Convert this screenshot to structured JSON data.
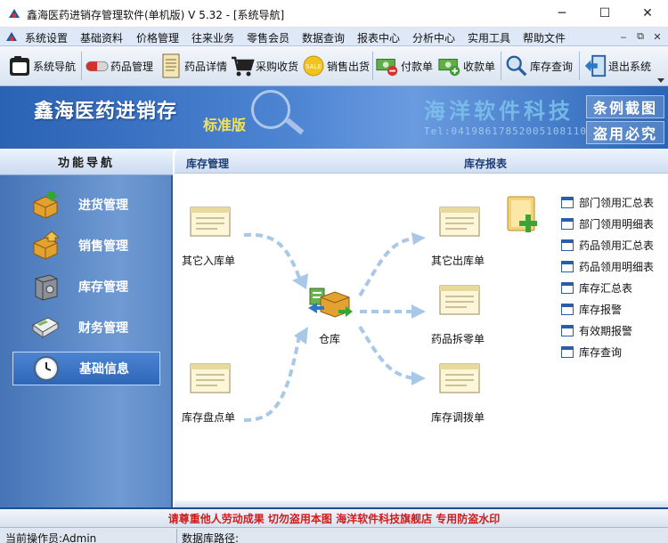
{
  "window": {
    "title": "鑫海医药进销存管理软件(单机版) V 5.32 - [系统导航]",
    "minimize_glyph": "─",
    "maximize_glyph": "☐",
    "close_glyph": "✕"
  },
  "menubar": {
    "items": [
      {
        "label": "系统设置"
      },
      {
        "label": "基础资料"
      },
      {
        "label": "价格管理"
      },
      {
        "label": "往来业务"
      },
      {
        "label": "零售会员"
      },
      {
        "label": "数据查询"
      },
      {
        "label": "报表中心"
      },
      {
        "label": "分析中心"
      },
      {
        "label": "实用工具"
      },
      {
        "label": "帮助文件"
      }
    ],
    "mdi_minimize": "‒",
    "mdi_restore": "⧉",
    "mdi_close": "✕"
  },
  "toolbar": {
    "buttons": [
      {
        "label": "系统导航",
        "icon": "navigation-icon"
      },
      {
        "label": "药品管理",
        "icon": "capsule-icon"
      },
      {
        "label": "药品详情",
        "icon": "document-icon"
      },
      {
        "label": "采购收货",
        "icon": "cart-icon"
      },
      {
        "label": "销售出货",
        "icon": "sale-tag-icon"
      },
      {
        "label": "付款单",
        "icon": "payment-icon"
      },
      {
        "label": "收款单",
        "icon": "receipt-icon"
      },
      {
        "label": "库存查询",
        "icon": "magnifier-icon"
      },
      {
        "label": "退出系统",
        "icon": "exit-icon"
      }
    ],
    "sale_tag_text": "SALE"
  },
  "banner": {
    "brand": "鑫海医药进销存",
    "edition": "标准版",
    "company_watermark": "海洋软件科技",
    "digits_watermark": "Tel:04198617852005108110",
    "sample_line1": "条例截图",
    "sample_line2": "盗用必究"
  },
  "leftnav": {
    "header": "功能导航",
    "items": [
      {
        "label": "进货管理",
        "icon": "inbound-box-icon"
      },
      {
        "label": "销售管理",
        "icon": "outbound-box-icon"
      },
      {
        "label": "库存管理",
        "icon": "safe-icon"
      },
      {
        "label": "财务管理",
        "icon": "calculator-icon"
      },
      {
        "label": "基础信息",
        "icon": "clock-icon",
        "active": true
      }
    ]
  },
  "main": {
    "section_inventory": "库存管理",
    "section_reports": "库存报表",
    "docs": {
      "other_in": "其它入库单",
      "stocktake": "库存盘点单",
      "warehouse": "仓库",
      "other_out": "其它出库单",
      "split": "药品拆零单",
      "transfer": "库存调拨单"
    },
    "reports": [
      "部门领用汇总表",
      "部门领用明细表",
      "药品领用汇总表",
      "药品领用明细表",
      "库存汇总表",
      "库存报警",
      "有效期报警",
      "库存查询"
    ]
  },
  "watermark_band": "请尊重他人劳动成果   切勿盗用本图   海洋软件科技旗舰店   专用防盗水印",
  "status": {
    "operator": "当前操作员:Admin",
    "db_path": "数据库路径:"
  },
  "colors": {
    "nav_bg": "#4f7fc0",
    "banner_bg": "#3f78c8",
    "watermark_red": "#d11a1a",
    "doc_paper": "#fdf6d8",
    "arrow": "#a8c8e8"
  }
}
